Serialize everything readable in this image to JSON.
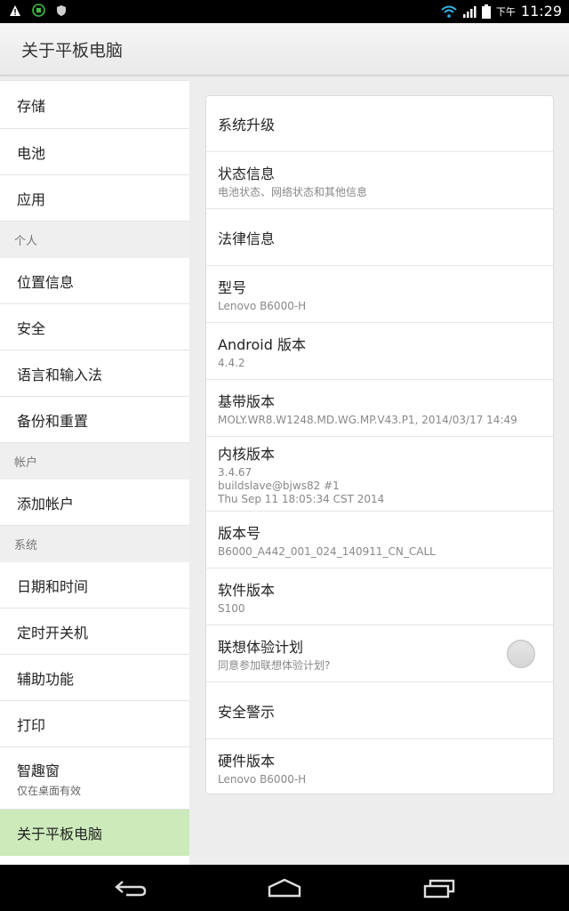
{
  "status_bar": {
    "icons": [
      "warning-icon",
      "app-badge-icon",
      "shield-icon",
      "wifi-icon",
      "signal-icon",
      "battery-icon"
    ],
    "ampm": "下午",
    "time": "11:29"
  },
  "action_bar": {
    "title": "关于平板电脑"
  },
  "sidebar": {
    "items": [
      {
        "type": "item",
        "label": "存储"
      },
      {
        "type": "item",
        "label": "电池"
      },
      {
        "type": "item",
        "label": "应用"
      },
      {
        "type": "header",
        "label": "个人"
      },
      {
        "type": "item",
        "label": "位置信息"
      },
      {
        "type": "item",
        "label": "安全"
      },
      {
        "type": "item",
        "label": "语言和输入法"
      },
      {
        "type": "item",
        "label": "备份和重置"
      },
      {
        "type": "header",
        "label": "帐户"
      },
      {
        "type": "item",
        "label": "添加帐户"
      },
      {
        "type": "header",
        "label": "系统"
      },
      {
        "type": "item",
        "label": "日期和时间"
      },
      {
        "type": "item",
        "label": "定时开关机"
      },
      {
        "type": "item",
        "label": "辅助功能"
      },
      {
        "type": "item",
        "label": "打印"
      },
      {
        "type": "item",
        "label": "智趣窗",
        "sub": "仅在桌面有效"
      },
      {
        "type": "item",
        "label": "关于平板电脑",
        "active": true
      }
    ]
  },
  "about": {
    "rows": [
      {
        "title": "系统升级"
      },
      {
        "title": "状态信息",
        "subtitle": "电池状态、网络状态和其他信息"
      },
      {
        "title": "法律信息"
      },
      {
        "title": "型号",
        "subtitle": "Lenovo B6000-H"
      },
      {
        "title": "Android 版本",
        "subtitle": "4.4.2"
      },
      {
        "title": "基带版本",
        "subtitle": "MOLY.WR8.W1248.MD.WG.MP.V43.P1, 2014/03/17 14:49"
      },
      {
        "title": "内核版本",
        "subtitle_lines": [
          "3.4.67",
          "buildslave@bjws82 #1",
          "Thu Sep 11 18:05:34 CST 2014"
        ]
      },
      {
        "title": "版本号",
        "subtitle": "B6000_A442_001_024_140911_CN_CALL"
      },
      {
        "title": "软件版本",
        "subtitle": "S100"
      },
      {
        "title": "联想体验计划",
        "subtitle": "同意参加联想体验计划?",
        "toggle": true,
        "checked": false
      },
      {
        "title": "安全警示"
      },
      {
        "title": "硬件版本",
        "subtitle": "Lenovo B6000-H"
      }
    ]
  },
  "nav_bar": {
    "buttons": [
      "back-icon",
      "home-icon",
      "recent-apps-icon"
    ]
  }
}
